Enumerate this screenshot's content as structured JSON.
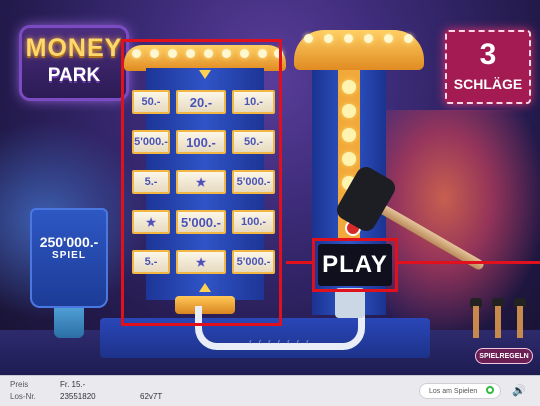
{
  "logo": {
    "line1": "MONEY",
    "line2": "PARK"
  },
  "hits_sign": {
    "count": "3",
    "label": "SCHLÄGE"
  },
  "prize_stand": {
    "amount": "250'000.-",
    "label": "SPIEL"
  },
  "prize_grid": [
    [
      "50.-",
      "20.-",
      "10.-"
    ],
    [
      "5'000.-",
      "100.-",
      "50.-"
    ],
    [
      "5.-",
      "★",
      "5'000.-"
    ],
    [
      "★",
      "5'000.-",
      "100.-"
    ],
    [
      "5.-",
      "★",
      "5'000.-"
    ]
  ],
  "play_button": {
    "label": "PLAY"
  },
  "rules_button": {
    "label": "SPIELREGELN"
  },
  "footer": {
    "price_label": "Preis",
    "price_value": "Fr. 15.-",
    "ticket_label": "Los-Nr.",
    "ticket_value": "23551820",
    "ticket_code": "62v7T",
    "autoplay_label": "Los am Spielen"
  },
  "colors": {
    "highlight_frame": "#e0111c",
    "cell_text": "#4a54b8",
    "toggle_active": "#2fbb41"
  },
  "icons": [
    "hammer-icon",
    "star-icon",
    "speaker-icon",
    "lever-icon"
  ]
}
